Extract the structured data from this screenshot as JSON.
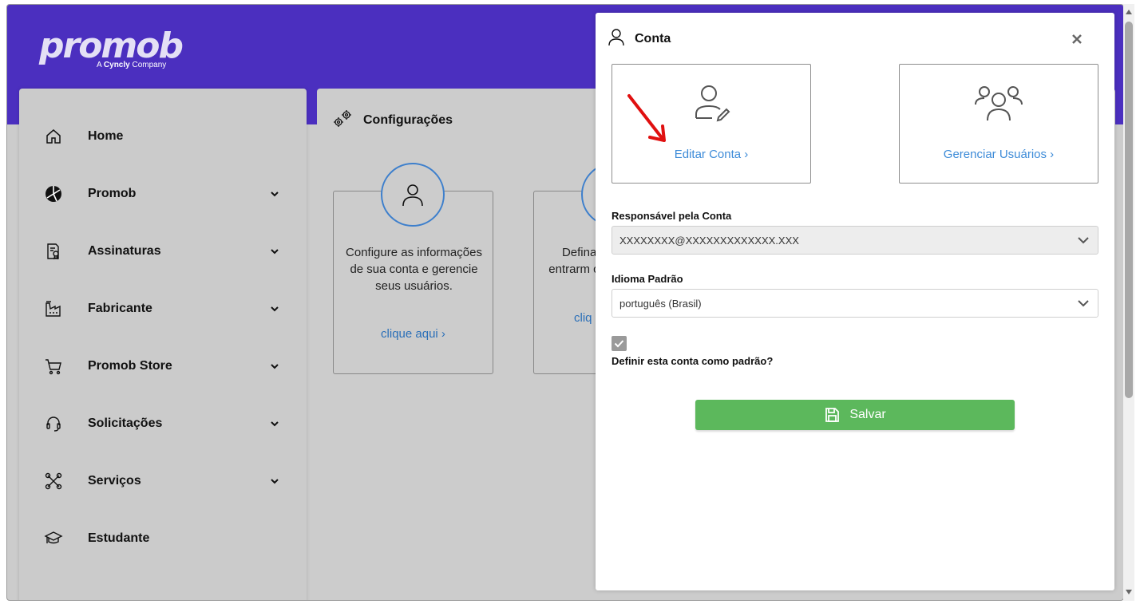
{
  "brand": {
    "name": "promob",
    "tagline_prefix": "A ",
    "tagline_company": "Cyncly",
    "tagline_suffix": " Company"
  },
  "colors": {
    "topbar": "#4b2fbf",
    "link": "#3d8bd8",
    "save": "#5cb85c",
    "circle": "#3d7fcc"
  },
  "sidebar": {
    "items": [
      {
        "label": "Home",
        "icon": "home-icon",
        "has_chevron": false
      },
      {
        "label": "Promob",
        "icon": "promob-logo-icon",
        "has_chevron": true
      },
      {
        "label": "Assinaturas",
        "icon": "certificate-icon",
        "has_chevron": true
      },
      {
        "label": "Fabricante",
        "icon": "factory-icon",
        "has_chevron": true
      },
      {
        "label": "Promob Store",
        "icon": "cart-icon",
        "has_chevron": true
      },
      {
        "label": "Solicitações",
        "icon": "headset-icon",
        "has_chevron": true
      },
      {
        "label": "Serviços",
        "icon": "tools-icon",
        "has_chevron": true
      },
      {
        "label": "Estudante",
        "icon": "graduation-cap-icon",
        "has_chevron": false
      }
    ]
  },
  "main": {
    "title": "Configurações",
    "cards": [
      {
        "text": "Configure as informações de sua conta e gerencie seus usuários.",
        "link": "clique aqui  ›"
      },
      {
        "text": "Defina c entrarm co",
        "link": "cliq"
      }
    ]
  },
  "modal": {
    "title": "Conta",
    "options": [
      {
        "label": "Editar Conta  ›",
        "icon": "user-edit-icon"
      },
      {
        "label": "Gerenciar Usuários  ›",
        "icon": "users-group-icon"
      }
    ],
    "owner": {
      "label": "Responsável pela Conta",
      "value": "XXXXXXXX@XXXXXXXXXXXXX.XXX"
    },
    "language": {
      "label": "Idioma Padrão",
      "value": "português (Brasil)"
    },
    "default_account": {
      "label": "Definir esta conta como padrão?",
      "checked": true
    },
    "save_label": "Salvar"
  }
}
